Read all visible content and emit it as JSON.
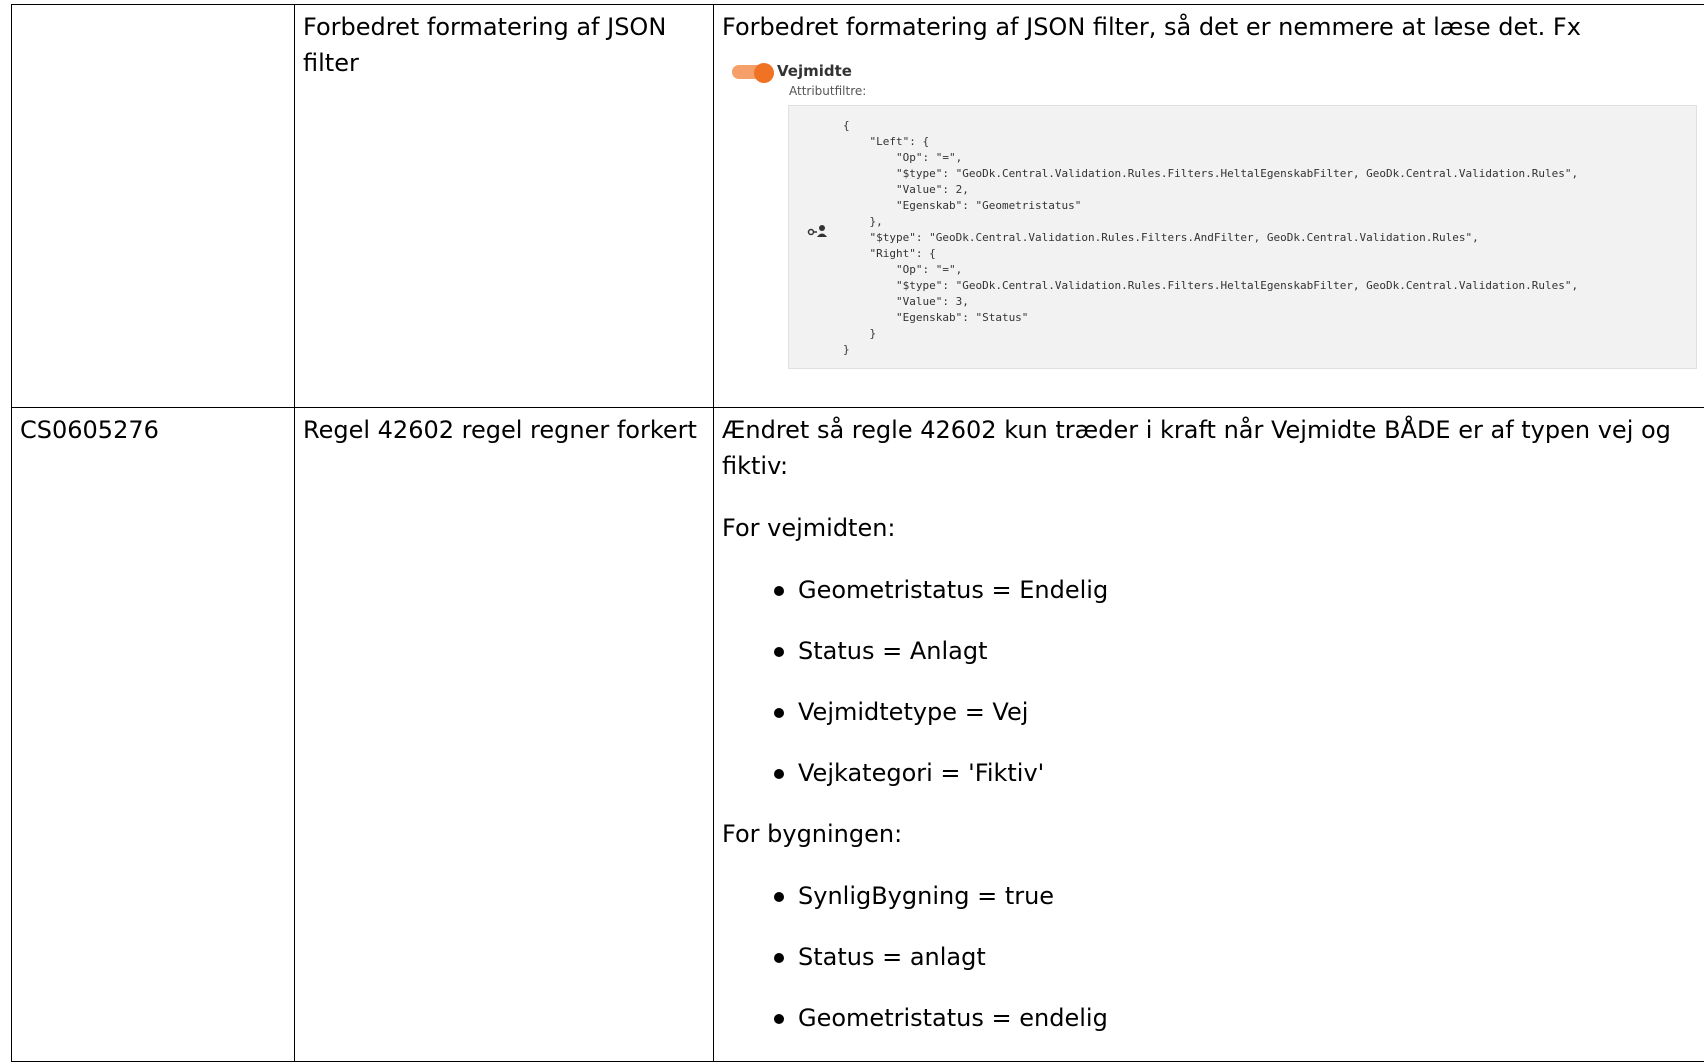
{
  "rows": [
    {
      "id": "",
      "title": "Forbedret formatering af JSON filter",
      "description": "Forbedret formatering af JSON filter, så det er nemmere at læse det. Fx",
      "screenshot": {
        "layer_name": "Vejmidte",
        "filter_label": "Attributfiltre:",
        "json": "{\n    \"Left\": {\n        \"Op\": \"=\",\n        \"$type\": \"GeoDk.Central.Validation.Rules.Filters.HeltalEgenskabFilter, GeoDk.Central.Validation.Rules\",\n        \"Value\": 2,\n        \"Egenskab\": \"Geometristatus\"\n    },\n    \"$type\": \"GeoDk.Central.Validation.Rules.Filters.AndFilter, GeoDk.Central.Validation.Rules\",\n    \"Right\": {\n        \"Op\": \"=\",\n        \"$type\": \"GeoDk.Central.Validation.Rules.Filters.HeltalEgenskabFilter, GeoDk.Central.Validation.Rules\",\n        \"Value\": 3,\n        \"Egenskab\": \"Status\"\n    }\n}",
        "toggle_color": "#f07324"
      }
    },
    {
      "id": "CS0605276",
      "title": "Regel 42602 regel regner forkert",
      "description": "Ændret så regle 42602 kun træder i kraft når Vejmidte BÅDE er af typen vej og fiktiv:",
      "section1_heading": "For vejmidten:",
      "section1_items": [
        "Geometristatus = Endelig",
        "Status = Anlagt",
        "Vejmidtetype = Vej",
        "Vejkategori = 'Fiktiv'"
      ],
      "section2_heading": "For bygningen:",
      "section2_items": [
        "SynligBygning = true",
        "Status = anlagt",
        "Geometristatus = endelig"
      ]
    }
  ]
}
